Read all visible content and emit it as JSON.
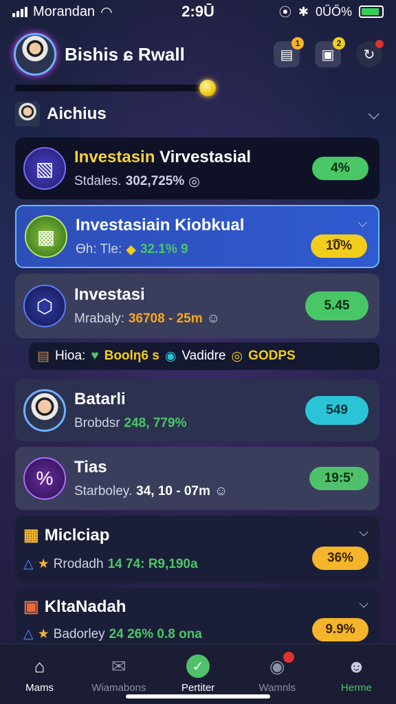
{
  "status_bar": {
    "carrier": "Morandan",
    "time": "2:9Ū",
    "battery": "0ŰŐ%",
    "battery_level": 0.9
  },
  "header": {
    "user_name": "Bishis ɕ Rwall",
    "badges": [
      "1",
      "2",
      ""
    ]
  },
  "progress": {
    "value": 0.52
  },
  "section": {
    "title": "Aichius"
  },
  "cards": [
    {
      "title": "Investasin Virvestasial",
      "sub_label": "Stdales.",
      "sub_value": "302,725%",
      "pill": "4%",
      "pill_color": "#49c766"
    },
    {
      "title": "Investasiain Kiobkual",
      "sub_label": "Ɵh: Tle:",
      "sub_value": "32.1% 9",
      "pill": "1͡0%",
      "pill_color": "#f2cd1c"
    },
    {
      "title": "Investasi",
      "sub_label": "Mrabaly:",
      "sub_value": "36708 - 25m",
      "pill": "5.45",
      "pill_color": "#49c766"
    }
  ],
  "info_strip": {
    "label1": "Hioa:",
    "value1": "Boolƞ6 s",
    "label2": "Vadidre",
    "value2": "GODPS"
  },
  "cards2": [
    {
      "title": "Batarli",
      "sub_label": "Brobdsr",
      "sub_value": "248, 779%",
      "pill": "549",
      "pill_color": "#29c5d6"
    },
    {
      "title": "Tias",
      "sub_label": "Starboley.",
      "sub_value": "34, 10 - 07m",
      "pill": "19:5ʹ",
      "pill_color": "#4fc16b"
    },
    {
      "title": "Miclciap",
      "sub_label": "Rrodadh",
      "sub_value": "14 74: R9,190a",
      "pill": "36%",
      "pill_color": "#f5b52a"
    },
    {
      "title": "KltaNadah",
      "sub_label": "Badorley",
      "sub_value": "24 26% 0.8 ona",
      "pill": "9.9%",
      "pill_color": "#f5b52a"
    }
  ],
  "nav": [
    {
      "label": "Mams",
      "icon": "home-icon",
      "color": "#ffffff"
    },
    {
      "label": "Wiamabons",
      "icon": "mail-icon",
      "color": "#8c90a8"
    },
    {
      "label": "Pertiter",
      "icon": "check-circle-icon",
      "color": "#ffffff"
    },
    {
      "label": "Wamnls",
      "icon": "camera-icon",
      "color": "#8c90a8"
    },
    {
      "label": "Herme",
      "icon": "profile-icon",
      "color": "#4fc16b"
    }
  ]
}
